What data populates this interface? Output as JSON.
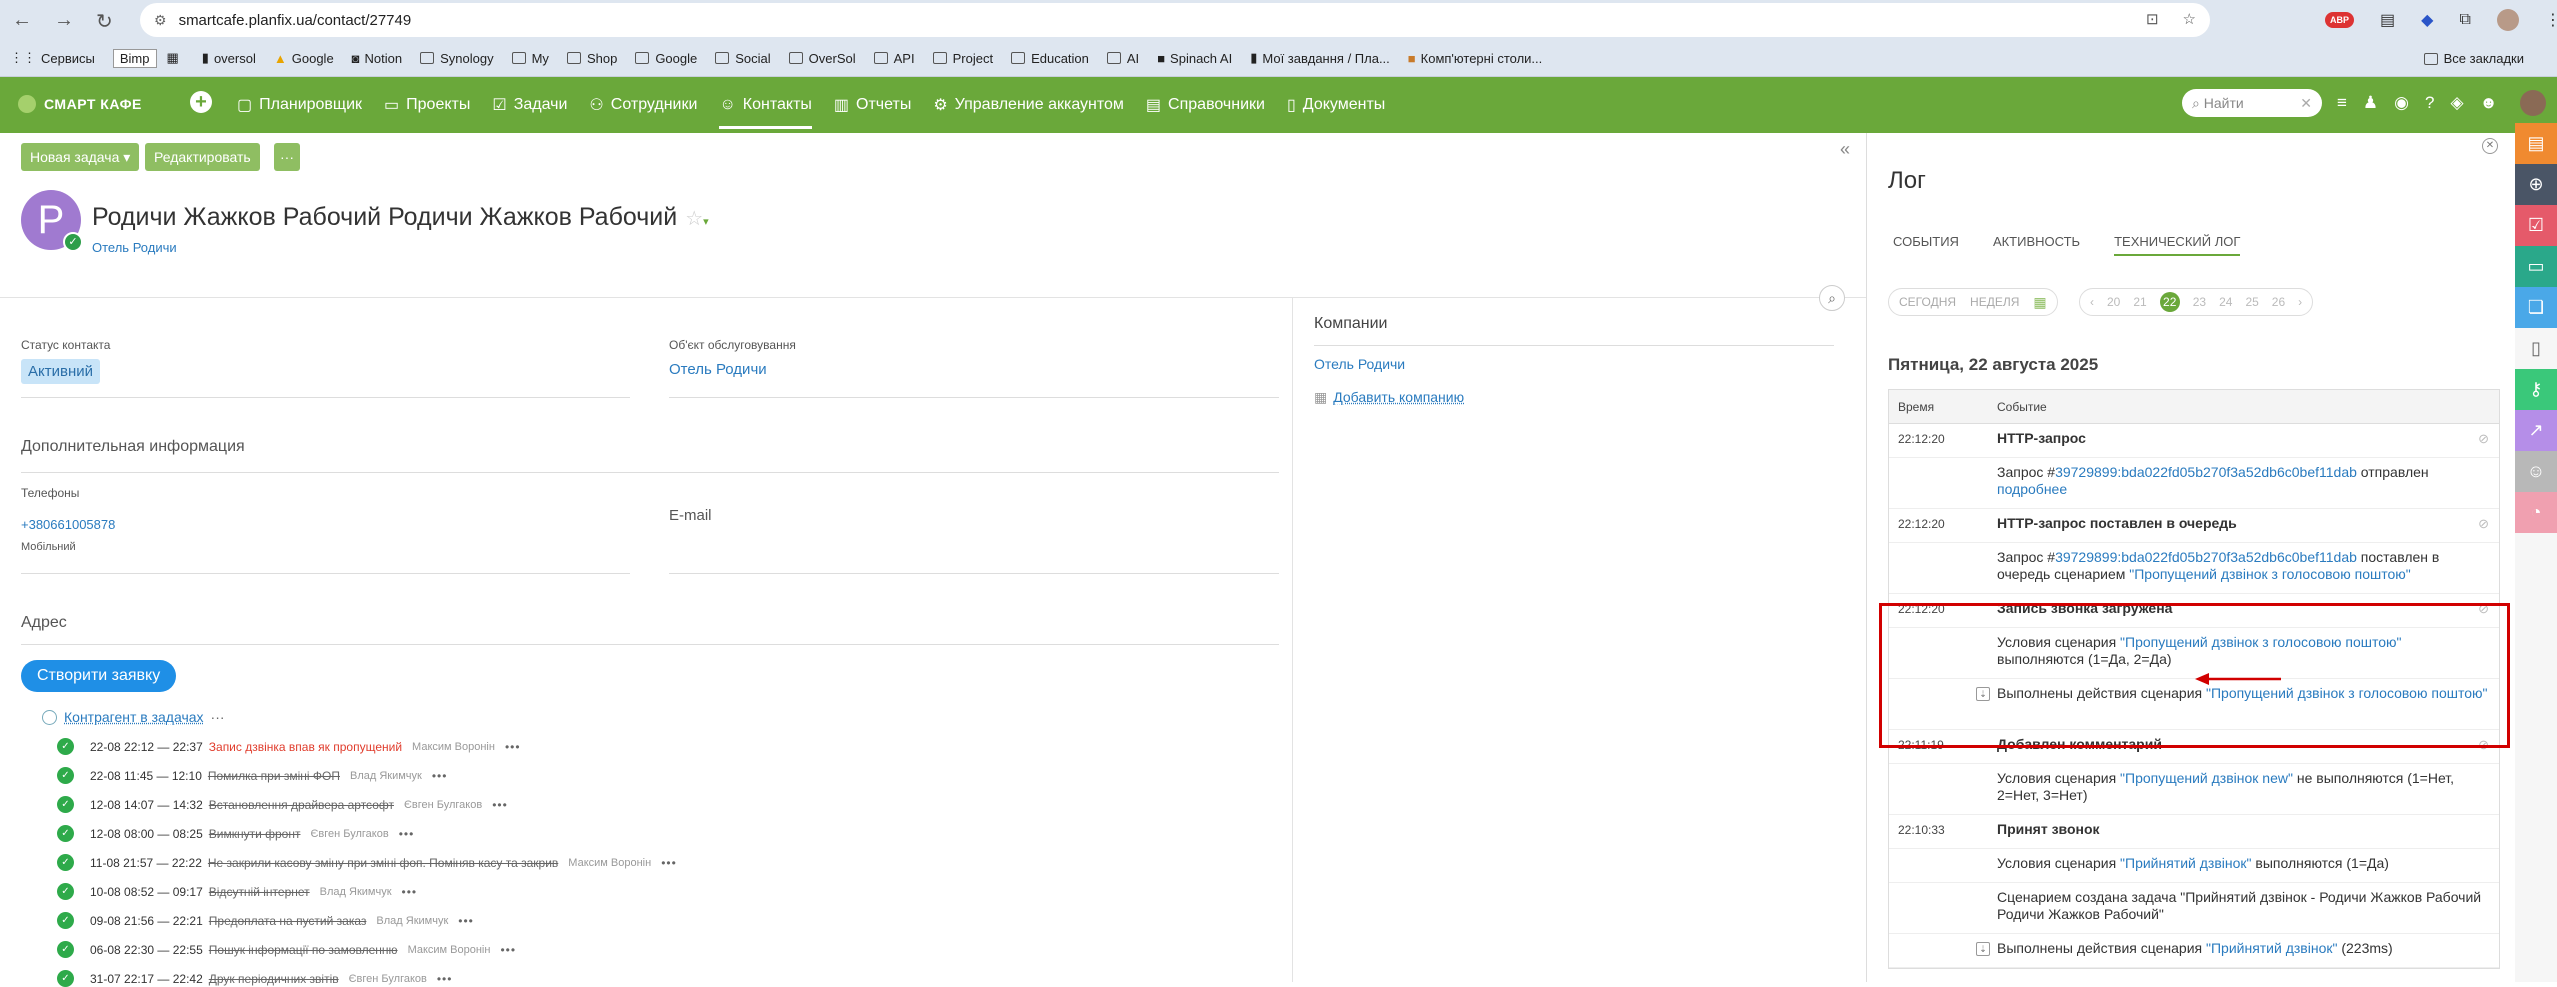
{
  "browser": {
    "url": "smartcafe.planfix.ua/contact/27749",
    "bookmarks": [
      "Сервисы",
      "Bimp",
      "",
      "oversol",
      "Google",
      "Notion",
      "Synology",
      "My",
      "Shop",
      "Google",
      "Social",
      "OverSol",
      "API",
      "Project",
      "Education",
      "AI",
      "Spinach AI",
      "Мої завдання / Пла...",
      "Комп'ютерні столи..."
    ],
    "all_bookmarks": "Все закладки"
  },
  "app": {
    "logo": "СМАРТ КАФЕ",
    "nav": [
      "Планировщик",
      "Проекты",
      "Задачи",
      "Сотрудники",
      "Контакты",
      "Отчеты",
      "Управление аккаунтом",
      "Справочники",
      "Документы"
    ],
    "active_nav": "Контакты",
    "search_placeholder": "Найти"
  },
  "contact": {
    "new_task": "Новая задача ▾",
    "edit": "Редактировать",
    "more": "···",
    "avatar_letter": "Р",
    "name": "Родичи Жажков Рабочий Родичи Жажков Рабочий",
    "company": "Отель Родичи",
    "status_label": "Статус контакта",
    "status_value": "Активний",
    "object_label": "Об'єкт обслуговування",
    "object_value": "Отель Родичи",
    "additional": "Дополнительная информация",
    "phones_label": "Телефоны",
    "phone": "+380661005878",
    "phone_type": "Мобільний",
    "email_label": "E-mail",
    "address_label": "Адрес",
    "create_request": "Створити заявку",
    "contractor": "Контрагент в задачах",
    "contractor_more": "···",
    "companies_title": "Компании",
    "companies_link": "Отель Родичи",
    "add_company": "Добавить компанию"
  },
  "tasks": [
    {
      "time": "22-08 22:12 — 22:37",
      "title": "Запис дзвінка впав як пропущений",
      "author": "Максим Воронін",
      "red": true
    },
    {
      "time": "22-08 11:45 — 12:10",
      "title": "Помилка при зміні ФОП",
      "author": "Влад Якимчук"
    },
    {
      "time": "12-08 14:07 — 14:32",
      "title": "Встановлення драйвера артсофт",
      "author": "Євген Булгаков"
    },
    {
      "time": "12-08 08:00 — 08:25",
      "title": "Вимкнути фронт",
      "author": "Євген Булгаков"
    },
    {
      "time": "11-08 21:57 — 22:22",
      "title": "Не закрили касову зміну при зміні фоп. Поміняв касу та закрив",
      "author": "Максим Воронін"
    },
    {
      "time": "10-08 08:52 — 09:17",
      "title": "Відсутній інтернет",
      "author": "Влад Якимчук"
    },
    {
      "time": "09-08 21:56 — 22:21",
      "title": "Предоплата на пустий заказ",
      "author": "Влад Якимчук"
    },
    {
      "time": "06-08 22:30 — 22:55",
      "title": "Пошук інформації по замовленню",
      "author": "Максим Воронін"
    },
    {
      "time": "31-07 22:17 — 22:42",
      "title": "Друк періодичних звітів",
      "author": "Євген Булгаков"
    }
  ],
  "log": {
    "title": "Лог",
    "tabs": [
      "СОБЫТИЯ",
      "АКТИВНОСТЬ",
      "ТЕХНИЧЕСКИЙ ЛОГ"
    ],
    "active_tab": "ТЕХНИЧЕСКИЙ ЛОГ",
    "today": "СЕГОДНЯ",
    "week": "НЕДЕЛЯ",
    "days": [
      "20",
      "21",
      "22",
      "23",
      "24",
      "25",
      "26"
    ],
    "selected_day": "22",
    "date": "Пятница, 22 августа 2025",
    "col_time": "Время",
    "col_event": "Событие",
    "rows": [
      {
        "time": "22:12:20",
        "event": "HTTP-запрос"
      },
      {
        "parts": [
          "Запрос #",
          "39729899:bda022fd05b270f3a52db6c0bef11dab",
          " отправлен "
        ],
        "link2": "подробнее"
      },
      {
        "time": "22:12:20",
        "event": "HTTP-запрос поставлен в очередь"
      },
      {
        "parts": [
          "Запрос #",
          "39729899:bda022fd05b270f3a52db6c0bef11dab",
          " поставлен в очередь сценарием "
        ],
        "link2": "\"Пропущений дзвінок з голосовою поштою\""
      },
      {
        "time": "22:12:20",
        "event": "Запись звонка загружена"
      },
      {
        "parts": [
          "Условия сценария ",
          "\"Пропущений дзвінок з голосовою поштою\"",
          " выполняются (1=Да, 2=Да)"
        ]
      },
      {
        "parts": [
          "Выполнены действия сценария ",
          "\"Пропущений дзвінок з голосовою поштою\"",
          ""
        ]
      },
      {
        "time": "22:11:19",
        "event": "Добавлен комментарий"
      },
      {
        "parts": [
          "Условия сценария ",
          "\"Пропущений дзвінок new\"",
          " не выполняются (1=Нет, 2=Нет, 3=Нет)"
        ]
      },
      {
        "time": "22:10:33",
        "event": "Принят звонок"
      },
      {
        "parts": [
          "Условия сценария ",
          "\"Прийнятий дзвінок\"",
          " выполняются (1=Да)"
        ]
      },
      {
        "parts": [
          "Сценарием создана задача \"Прийнятий дзвінок - Родичи Жажков Рабочий Родичи Жажков Рабочий\"",
          "",
          ""
        ]
      },
      {
        "parts": [
          "Выполнены действия сценария ",
          "\"Прийнятий дзвінок\"",
          " (223ms)"
        ]
      }
    ]
  },
  "colors": {
    "brand": "#6aa83a",
    "link": "#2a7bbf",
    "highlight": "#d10000"
  }
}
